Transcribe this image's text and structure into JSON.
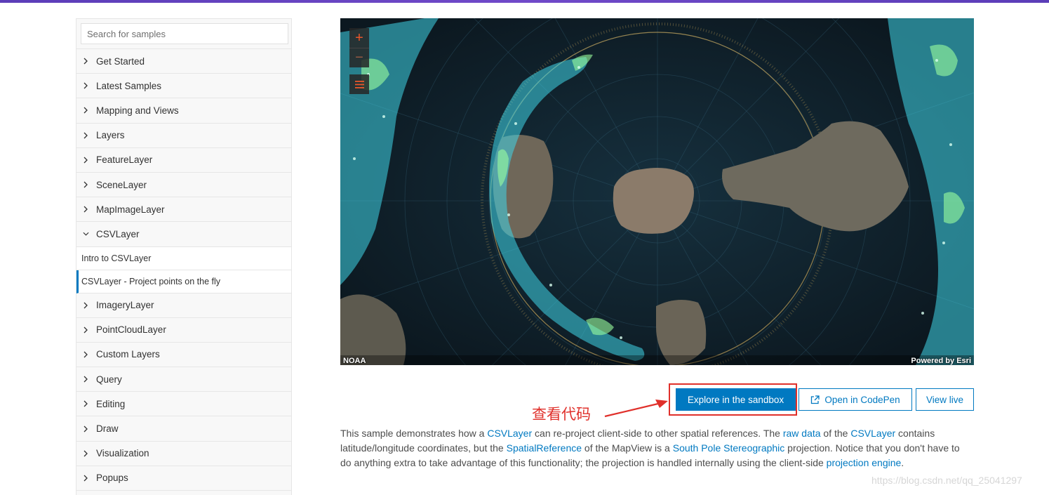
{
  "sidebar": {
    "search_placeholder": "Search for samples",
    "items_before": [
      {
        "label": "Get Started"
      },
      {
        "label": "Latest Samples"
      },
      {
        "label": "Mapping and Views"
      },
      {
        "label": "Layers"
      },
      {
        "label": "FeatureLayer"
      },
      {
        "label": "SceneLayer"
      },
      {
        "label": "MapImageLayer"
      }
    ],
    "expanded_item": {
      "label": "CSVLayer"
    },
    "sub_items": [
      {
        "label": "Intro to CSVLayer"
      },
      {
        "label": "CSVLayer - Project points on the fly"
      }
    ],
    "items_after": [
      {
        "label": "ImageryLayer"
      },
      {
        "label": "PointCloudLayer"
      },
      {
        "label": "Custom Layers"
      },
      {
        "label": "Query"
      },
      {
        "label": "Editing"
      },
      {
        "label": "Draw"
      },
      {
        "label": "Visualization"
      },
      {
        "label": "Popups"
      }
    ]
  },
  "map": {
    "zoom_in": "+",
    "zoom_out": "−",
    "attribution_left": "NOAA",
    "attribution_right": "Powered by Esri"
  },
  "buttons": {
    "sandbox": "Explore in the sandbox",
    "codepen": "Open in CodePen",
    "live": "View live"
  },
  "annotation": "查看代码",
  "description": {
    "p1": "This sample demonstrates how a ",
    "link1": "CSVLayer",
    "p2": " can re-project client-side to other spatial references. The ",
    "link2": "raw data",
    "p3": " of the ",
    "link3": "CSVLayer",
    "p4": " contains latitude/longitude coordinates, but the ",
    "link4": "SpatialReference",
    "p5": " of the MapView is a ",
    "link5": "South Pole Stereographic",
    "p6": " projection. Notice that you don't have to do anything extra to take advantage of this functionality; the projection is handled internally using the client-side ",
    "link6": "projection engine",
    "p7": "."
  },
  "watermark": "https://blog.csdn.net/qq_25041297",
  "colors": {
    "accent": "#0079c1",
    "annotation": "#e0302b",
    "topbar": "#6a45c4"
  }
}
